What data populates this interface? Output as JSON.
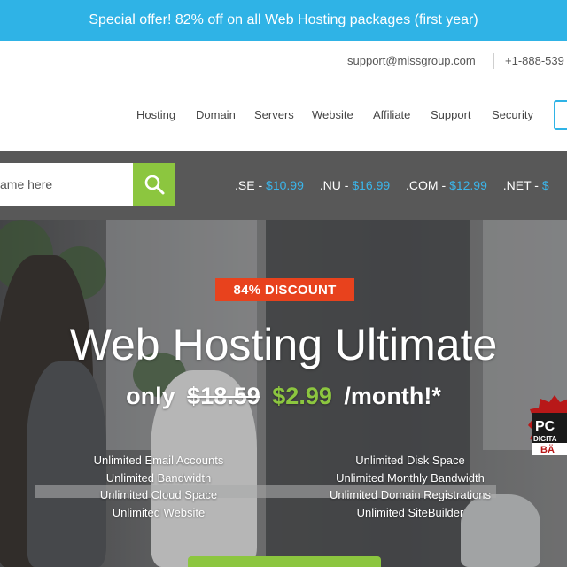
{
  "offer_banner": {
    "text": "Special offer! 82% off on all Web Hosting packages (first year)"
  },
  "contact": {
    "email": "support@missgroup.com",
    "phone": "+1-888-539"
  },
  "nav": {
    "items": [
      "Hosting",
      "Domain",
      "Servers",
      "Website",
      "Affiliate",
      "Support",
      "Security"
    ]
  },
  "domain_search": {
    "placeholder": "ame here",
    "button_icon": "search-icon",
    "prices": [
      {
        "tld": ".SE",
        "price": "$10.99"
      },
      {
        "tld": ".NU",
        "price": "$16.99"
      },
      {
        "tld": ".COM",
        "price": "$12.99"
      },
      {
        "tld": ".NET",
        "price": "$"
      }
    ]
  },
  "hero": {
    "badge": "84% DISCOUNT",
    "title": "Web Hosting Ultimate",
    "price_prefix": "only",
    "old_price": "$18.59",
    "new_price": "$2.99",
    "price_suffix": "/month!*",
    "features_left": [
      "Unlimited Email Accounts",
      "Unlimited Bandwidth",
      "Unlimited Cloud Space",
      "Unlimited Website"
    ],
    "features_right": [
      "Unlimited Disk Space",
      "Unlimited Monthly Bandwidth",
      "Unlimited Domain Registrations",
      "Unlimited SiteBuilder"
    ],
    "award": {
      "line1": "PC",
      "line2": "DIGITA",
      "line3": "BÄ"
    }
  },
  "colors": {
    "accent": "#2fb3e6",
    "green": "#8cc63f",
    "badge": "#e8421d",
    "bar": "#585858"
  }
}
